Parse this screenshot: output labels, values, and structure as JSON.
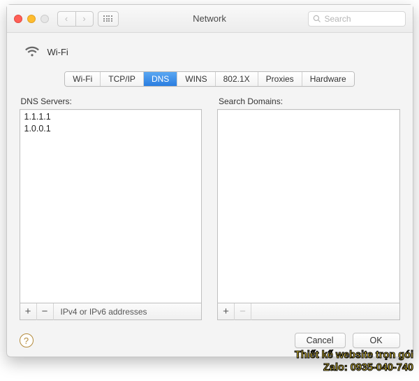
{
  "titlebar": {
    "title": "Network",
    "search_placeholder": "Search"
  },
  "service": {
    "name": "Wi-Fi"
  },
  "tabs": [
    {
      "label": "Wi-Fi",
      "active": false
    },
    {
      "label": "TCP/IP",
      "active": false
    },
    {
      "label": "DNS",
      "active": true
    },
    {
      "label": "WINS",
      "active": false
    },
    {
      "label": "802.1X",
      "active": false
    },
    {
      "label": "Proxies",
      "active": false
    },
    {
      "label": "Hardware",
      "active": false
    }
  ],
  "dns": {
    "label": "DNS Servers:",
    "servers": [
      "1.1.1.1",
      "1.0.0.1"
    ],
    "footer_text": "IPv4 or IPv6 addresses",
    "add": "+",
    "remove": "−"
  },
  "search_domains": {
    "label": "Search Domains:",
    "domains": [],
    "add": "+",
    "remove": "−"
  },
  "buttons": {
    "cancel": "Cancel",
    "ok": "OK"
  },
  "help": "?",
  "watermark": {
    "line1": "Thiết kế website trọn gói",
    "line2": "Zalo: 0935-040-740"
  }
}
